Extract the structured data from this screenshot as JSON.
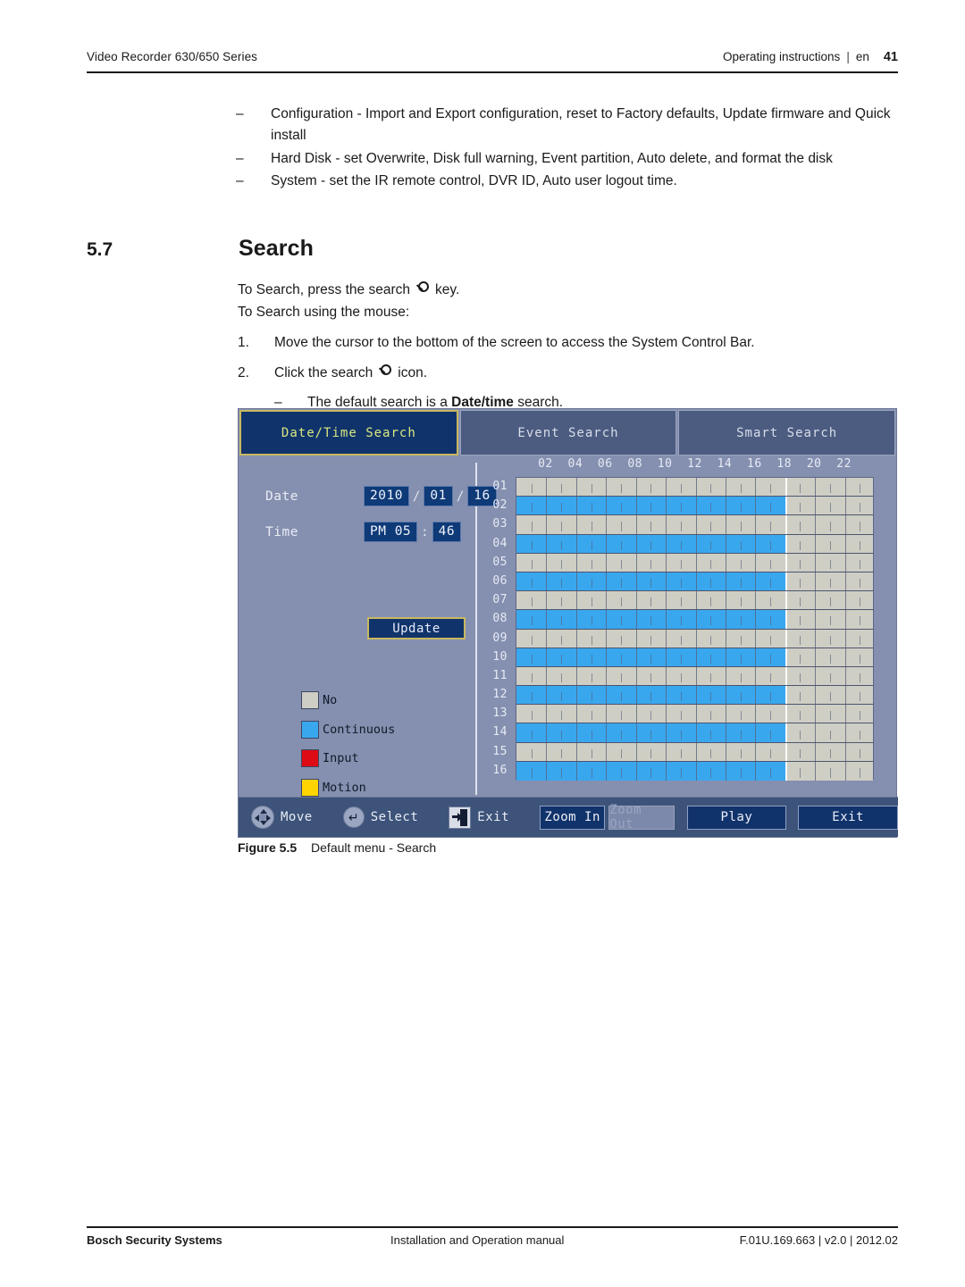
{
  "header": {
    "left": "Video Recorder 630/650 Series",
    "right": "Operating instructions",
    "separator": "|",
    "lang": "en",
    "page": "41"
  },
  "bullets": [
    {
      "dash": "–",
      "text": "Configuration - Import and Export configuration, reset to Factory defaults, Update firmware and Quick install"
    },
    {
      "dash": "–",
      "text": "Hard Disk - set Overwrite, Disk full warning, Event partition, Auto delete, and format the disk"
    },
    {
      "dash": "–",
      "text": "System - set the IR remote control, DVR ID, Auto user logout time."
    }
  ],
  "section": {
    "number": "5.7",
    "title": "Search"
  },
  "instructions": {
    "line1_a": "To Search, press the search",
    "line1_b": "key.",
    "line2": "To Search using the mouse:",
    "step1_num": "1.",
    "step1_text": "Move the cursor to the bottom of the screen to access the System Control Bar.",
    "step2_num": "2.",
    "step2_a": "Click the search",
    "step2_b": "icon.",
    "sub_dash": "–",
    "sub_a": "The default search is a",
    "sub_bold": "Date/time",
    "sub_b": "search."
  },
  "dvr": {
    "tabs": [
      {
        "label": "Date/Time Search",
        "active": true
      },
      {
        "label": "Event Search",
        "active": false
      },
      {
        "label": "Smart Search",
        "active": false
      }
    ],
    "date": {
      "label": "Date",
      "year": "2010",
      "month": "01",
      "day": "16",
      "sep": "/"
    },
    "time": {
      "label": "Time",
      "hour": "PM 05",
      "minute": "46",
      "sep": ":"
    },
    "update_button": "Update",
    "legend": [
      {
        "label": "No",
        "color": "#cfcec4"
      },
      {
        "label": "Continuous",
        "color": "#39a7ee"
      },
      {
        "label": "Input",
        "color": "#dd0b16"
      },
      {
        "label": "Motion",
        "color": "#ffd400"
      }
    ],
    "hour_labels": [
      "02",
      "04",
      "06",
      "08",
      "10",
      "12",
      "14",
      "16",
      "18",
      "20",
      "22"
    ],
    "channels": [
      "01",
      "02",
      "03",
      "04",
      "05",
      "06",
      "07",
      "08",
      "09",
      "10",
      "11",
      "12",
      "13",
      "14",
      "15",
      "16"
    ],
    "recording_hours_end": 18,
    "row_types": [
      "no",
      "continuous",
      "no",
      "continuous",
      "no",
      "continuous",
      "no",
      "continuous",
      "no",
      "continuous",
      "no",
      "continuous",
      "no",
      "continuous",
      "no",
      "continuous"
    ],
    "controls": {
      "hints": [
        {
          "icon": "dpad-icon",
          "label": "Move"
        },
        {
          "icon": "enter-icon",
          "label": "Select"
        },
        {
          "icon": "exit-icon",
          "label": "Exit"
        }
      ],
      "buttons": [
        {
          "label": "Zoom In",
          "disabled": false
        },
        {
          "label": "Zoom Out",
          "disabled": true
        },
        {
          "label": "Play",
          "disabled": false
        },
        {
          "label": "Exit",
          "disabled": false
        }
      ]
    }
  },
  "figure": {
    "label": "Figure 5.5",
    "caption": "Default menu - Search"
  },
  "footer": {
    "left": "Bosch Security Systems",
    "center": "Installation and Operation manual",
    "right": "F.01U.169.663 | v2.0 | 2012.02"
  }
}
